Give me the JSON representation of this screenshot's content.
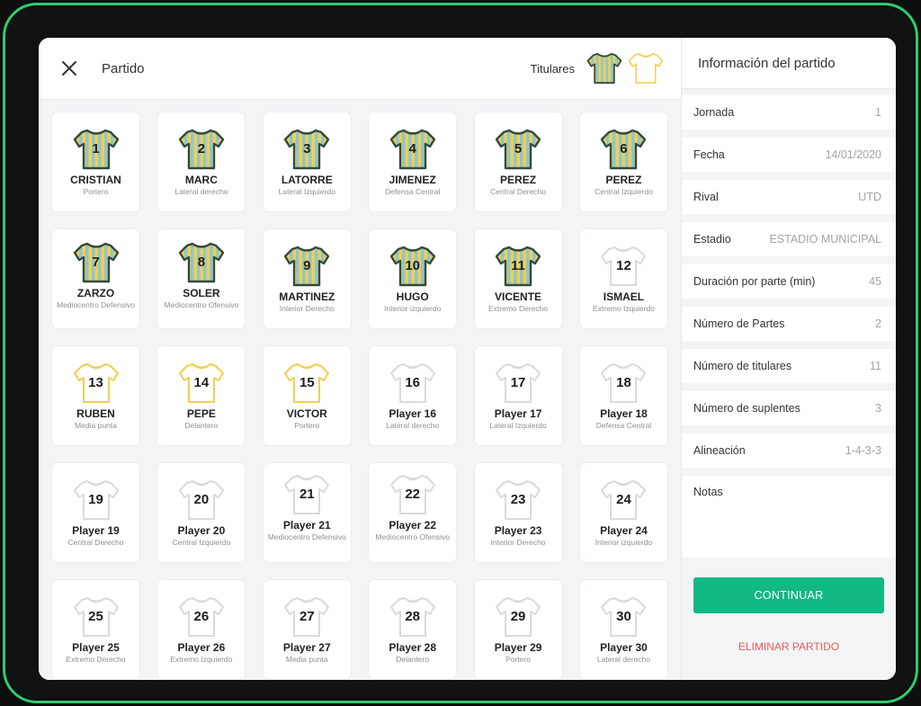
{
  "header": {
    "title": "Partido",
    "starters_label": "Titulares"
  },
  "colors": {
    "accent": "#12b886",
    "frame": "#2ecc71",
    "kit_stripe_yellow": "#f2cf4f",
    "kit_stripe_blue": "#8ec6d1",
    "kit_outline": "#334a3a",
    "sub_outline": "#f2cf4f",
    "bench_outline": "#d8dadc",
    "delete": "#ee5a5a"
  },
  "players": [
    {
      "number": "1",
      "name": "CRISTIAN",
      "position": "Portero",
      "kit": "starter"
    },
    {
      "number": "2",
      "name": "MARC",
      "position": "Lateral derecho",
      "kit": "starter"
    },
    {
      "number": "3",
      "name": "LATORRE",
      "position": "Lateral Izquierdo",
      "kit": "starter"
    },
    {
      "number": "4",
      "name": "JIMENEZ",
      "position": "Defensa Central",
      "kit": "starter"
    },
    {
      "number": "5",
      "name": "PEREZ",
      "position": "Central Derecho",
      "kit": "starter"
    },
    {
      "number": "6",
      "name": "PEREZ",
      "position": "Central Izquierdo",
      "kit": "starter"
    },
    {
      "number": "7",
      "name": "ZARZO",
      "position": "Mediocentro Defensivo",
      "kit": "starter"
    },
    {
      "number": "8",
      "name": "SOLER",
      "position": "Mediocentro Ofensivo",
      "kit": "starter"
    },
    {
      "number": "9",
      "name": "MARTINEZ",
      "position": "Interior Derecho",
      "kit": "starter"
    },
    {
      "number": "10",
      "name": "HUGO",
      "position": "Interior izquierdo",
      "kit": "starter"
    },
    {
      "number": "11",
      "name": "VICENTE",
      "position": "Extremo Derecho",
      "kit": "starter"
    },
    {
      "number": "12",
      "name": "ISMAEL",
      "position": "Extremo Izquierdo",
      "kit": "bench"
    },
    {
      "number": "13",
      "name": "RUBEN",
      "position": "Media punta",
      "kit": "sub"
    },
    {
      "number": "14",
      "name": "PEPE",
      "position": "Delantero",
      "kit": "sub"
    },
    {
      "number": "15",
      "name": "VICTOR",
      "position": "Portero",
      "kit": "sub"
    },
    {
      "number": "16",
      "name": "Player 16",
      "position": "Lateral derecho",
      "kit": "bench"
    },
    {
      "number": "17",
      "name": "Player 17",
      "position": "Lateral Izquierdo",
      "kit": "bench"
    },
    {
      "number": "18",
      "name": "Player 18",
      "position": "Defensa Central",
      "kit": "bench"
    },
    {
      "number": "19",
      "name": "Player 19",
      "position": "Central Derecho",
      "kit": "bench"
    },
    {
      "number": "20",
      "name": "Player 20",
      "position": "Central Izquierdo",
      "kit": "bench"
    },
    {
      "number": "21",
      "name": "Player 21",
      "position": "Mediocentro Defensivo",
      "kit": "bench"
    },
    {
      "number": "22",
      "name": "Player 22",
      "position": "Mediocentro Ofensivo",
      "kit": "bench"
    },
    {
      "number": "23",
      "name": "Player 23",
      "position": "Interior Derecho",
      "kit": "bench"
    },
    {
      "number": "24",
      "name": "Player 24",
      "position": "Interior izquierdo",
      "kit": "bench"
    },
    {
      "number": "25",
      "name": "Player 25",
      "position": "Extremo Derecho",
      "kit": "bench"
    },
    {
      "number": "26",
      "name": "Player 26",
      "position": "Extremo Izquierdo",
      "kit": "bench"
    },
    {
      "number": "27",
      "name": "Player 27",
      "position": "Media punta",
      "kit": "bench"
    },
    {
      "number": "28",
      "name": "Player 28",
      "position": "Delantero",
      "kit": "bench"
    },
    {
      "number": "29",
      "name": "Player 29",
      "position": "Portero",
      "kit": "bench"
    },
    {
      "number": "30",
      "name": "Player 30",
      "position": "Lateral derecho",
      "kit": "bench"
    }
  ],
  "match_info": {
    "title": "Información del partido",
    "fields": [
      {
        "label": "Jornada",
        "value": "1"
      },
      {
        "label": "Fecha",
        "value": "14/01/2020"
      },
      {
        "label": "Rival",
        "value": "UTD"
      },
      {
        "label": "Estadio",
        "value": "ESTADIO MUNICIPAL"
      },
      {
        "label": "Duración por parte (min)",
        "value": "45"
      },
      {
        "label": "Número de Partes",
        "value": "2"
      },
      {
        "label": "Número de titulares",
        "value": "11"
      },
      {
        "label": "Número de suplentes",
        "value": "3"
      },
      {
        "label": "Alineación",
        "value": "1-4-3-3"
      }
    ],
    "notes_label": "Notas",
    "continue_label": "CONTINUAR",
    "delete_label": "ELIMINAR PARTIDO"
  }
}
